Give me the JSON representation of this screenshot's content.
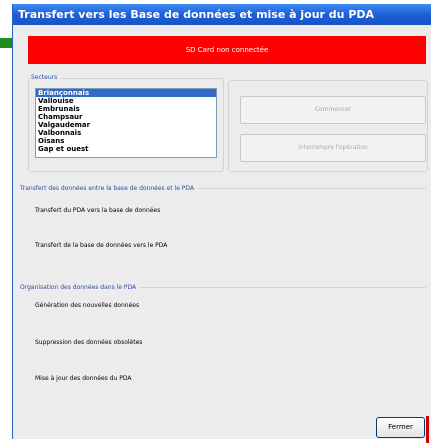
{
  "window": {
    "title": "Transfert vers les Base de données et mise à jour du PDA"
  },
  "status": {
    "message": "SD Card non connectée",
    "color": "#ff0000"
  },
  "secteurs": {
    "label": "Secteurs",
    "items": [
      "Briançonnais",
      "Vallouise",
      "Embrunais",
      "Champsaur",
      "Valgaudemar",
      "Valbonnais",
      "Oisans",
      "Gap et ouest"
    ],
    "selected": "Briançonnais"
  },
  "actions": {
    "start": "Commencer",
    "interrupt": "Interrompre l'opération"
  },
  "transfert": {
    "label": "Transfert des données entre la base de données et le PDA",
    "pda_to_db": "Transfert du PDA vers la base de données",
    "db_to_pda": "Transfert de la base de données vers le PDA"
  },
  "organisation": {
    "label": "Organisation des données dans le PDA",
    "generation": "Génération des nouvelles données",
    "suppression": "Suppression des données obsolètes",
    "miseajour": "Mise à jour des données du PDA"
  },
  "footer": {
    "close": "Fermer"
  },
  "colors": {
    "title_bar": "#1d5fd8",
    "selection": "#316ac5",
    "group_label": "#2a4ea0"
  }
}
